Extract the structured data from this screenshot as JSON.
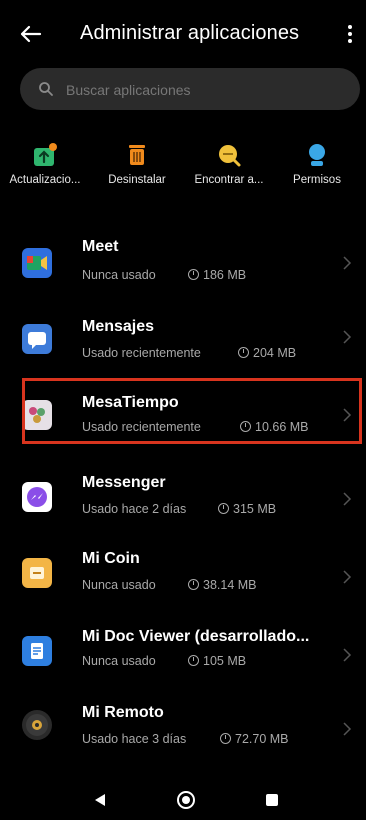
{
  "header": {
    "title": "Administrar aplicaciones"
  },
  "search": {
    "placeholder": "Buscar aplicaciones"
  },
  "actions": [
    {
      "label": "Actualizacio...",
      "icon": "update-icon",
      "color": "#2fb56e"
    },
    {
      "label": "Desinstalar",
      "icon": "trash-icon",
      "color": "#f08a1c"
    },
    {
      "label": "Encontrar a...",
      "icon": "search-app-icon",
      "color": "#f0c13b"
    },
    {
      "label": "Permisos",
      "icon": "permissions-icon",
      "color": "#3aa7e6"
    }
  ],
  "apps": [
    {
      "name": "Meet",
      "status": "Nunca usado",
      "size": "186 MB",
      "icon": "meet-icon"
    },
    {
      "name": "Mensajes",
      "status": "Usado recientemente",
      "size": "204 MB",
      "icon": "messages-icon"
    },
    {
      "name": "MesaTiempo",
      "status": "Usado recientemente",
      "size": "10.66 MB",
      "icon": "mesatiempo-icon"
    },
    {
      "name": "Messenger",
      "status": "Usado hace 2 días",
      "size": "315 MB",
      "icon": "messenger-icon"
    },
    {
      "name": "Mi Coin",
      "status": "Nunca usado",
      "size": "38.14 MB",
      "icon": "mi-coin-icon"
    },
    {
      "name": "Mi Doc Viewer (desarrollado...",
      "status": "Nunca usado",
      "size": "105 MB",
      "icon": "mi-doc-viewer-icon"
    },
    {
      "name": "Mi Remoto",
      "status": "Usado hace 3 días",
      "size": "72.70 MB",
      "icon": "mi-remote-icon"
    }
  ],
  "colors": {
    "background": "#000000",
    "highlight": "#d8341e",
    "secondary_text": "#a9a9a9"
  }
}
